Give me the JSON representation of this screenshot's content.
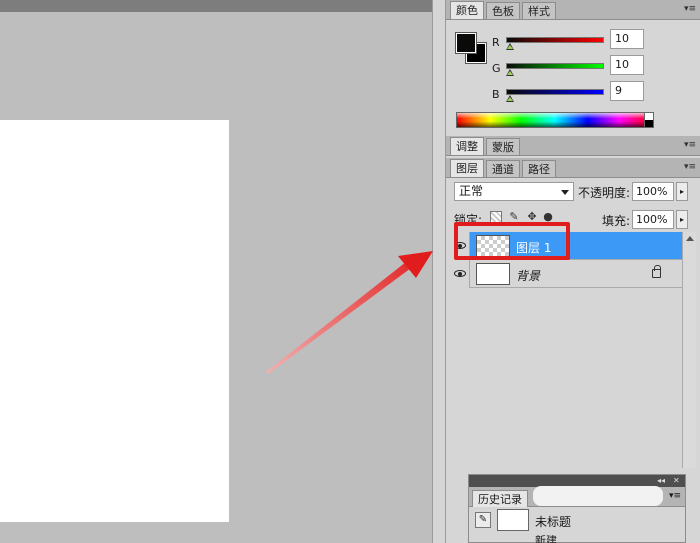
{
  "color_panel": {
    "tabs": [
      "颜色",
      "色板",
      "样式"
    ],
    "channels": [
      {
        "label": "R",
        "value": "10"
      },
      {
        "label": "G",
        "value": "10"
      },
      {
        "label": "B",
        "value": "9"
      }
    ],
    "foreground": "#0a0a09",
    "background": "#000000",
    "slider_colors": {
      "r": "#ff0000",
      "g": "#00ff00",
      "b": "#0000ff"
    }
  },
  "adjust_panel": {
    "tabs": [
      "调整",
      "蒙版"
    ]
  },
  "layers_panel": {
    "tabs": [
      "图层",
      "通道",
      "路径"
    ],
    "blend_mode": "正常",
    "opacity_label": "不透明度:",
    "opacity_value": "100%",
    "lock_label": "锁定:",
    "fill_label": "填充:",
    "fill_value": "100%",
    "layers": [
      {
        "name": "图层 1",
        "selected": true
      },
      {
        "name": "背景",
        "selected": false
      }
    ]
  },
  "history_panel": {
    "tab": "历史记录",
    "rows": [
      "未标题",
      "新建"
    ]
  },
  "annotation": {
    "highlight_color": "#e11c1c",
    "arrow_color": "#e11c1c"
  }
}
